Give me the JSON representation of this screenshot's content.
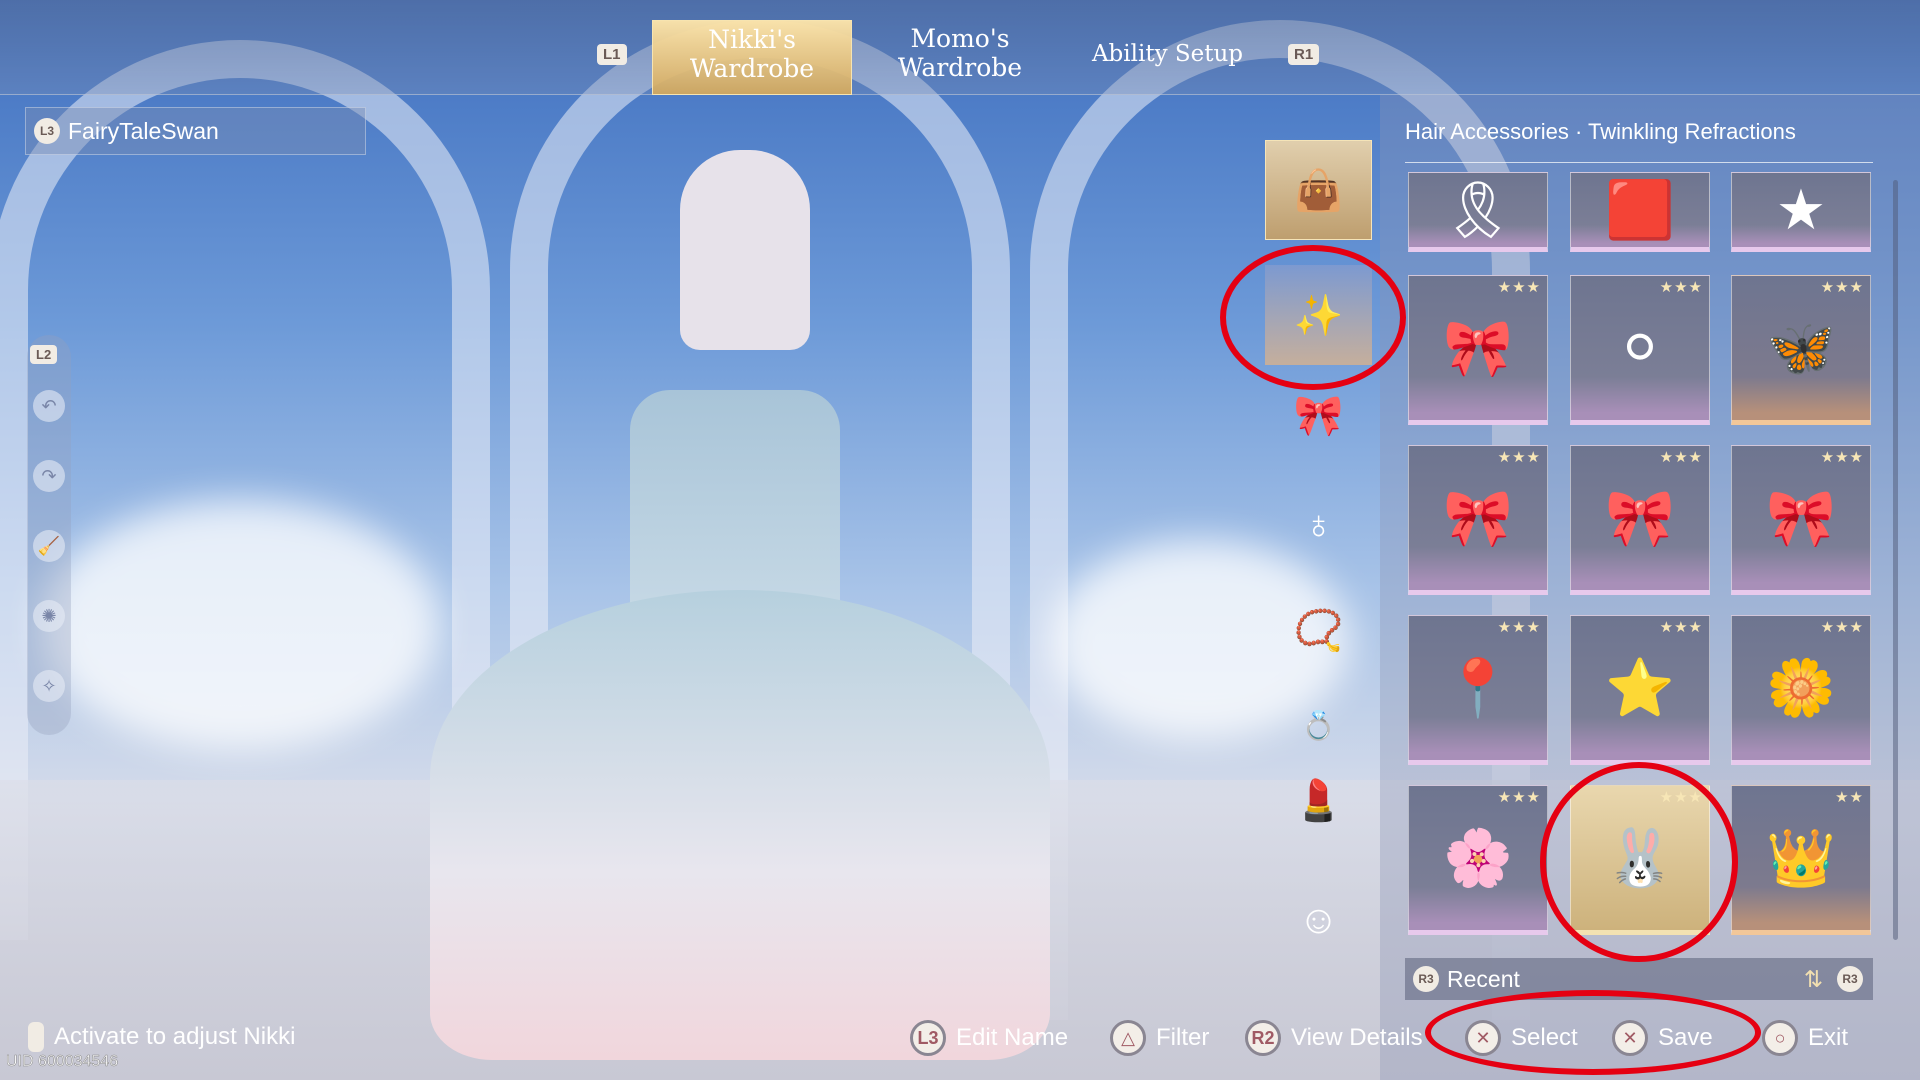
{
  "top_tabs": {
    "left_badge": "L1",
    "right_badge": "R1",
    "tabs": [
      {
        "label": "Nikki's Wardrobe",
        "active": true
      },
      {
        "label": "Momo's Wardrobe",
        "active": false
      },
      {
        "label": "Ability Setup",
        "active": false
      }
    ]
  },
  "outfit_name": {
    "badge": "L3",
    "value": "FairyTaleSwan"
  },
  "left_tools": {
    "badge": "L2",
    "icons": [
      "undo-icon",
      "redo-icon",
      "broom-icon",
      "pose-icon",
      "filter-effect-icon"
    ]
  },
  "categories": [
    {
      "icon": "bag-icon",
      "glyph": "👜",
      "selected": true
    },
    {
      "icon": "hair-accessory-icon",
      "glyph": "✨",
      "selected": false
    },
    {
      "icon": "hat-icon",
      "glyph": "🎀"
    },
    {
      "icon": "earrings-icon",
      "glyph": "♁"
    },
    {
      "icon": "necklace-icon",
      "glyph": "📿"
    },
    {
      "icon": "ring-icon",
      "glyph": "💍"
    },
    {
      "icon": "makeup-icon",
      "glyph": "💄"
    },
    {
      "icon": "face-icon",
      "glyph": "☺"
    }
  ],
  "panel": {
    "title": "Hair Accessories · Twinkling Refractions",
    "items": [
      {
        "glyph": "🎗",
        "stars": "",
        "style": ""
      },
      {
        "glyph": "🟥",
        "stars": "",
        "style": ""
      },
      {
        "glyph": "★",
        "stars": "",
        "style": ""
      },
      {
        "glyph": "🎀",
        "stars": "★★★",
        "style": ""
      },
      {
        "glyph": "⚪",
        "stars": "★★★",
        "style": ""
      },
      {
        "glyph": "🦋",
        "stars": "★★★",
        "style": "orange"
      },
      {
        "glyph": "🎀",
        "stars": "★★★",
        "style": ""
      },
      {
        "glyph": "🎀",
        "stars": "★★★",
        "style": ""
      },
      {
        "glyph": "🎀",
        "stars": "★★★",
        "style": ""
      },
      {
        "glyph": "📍",
        "stars": "★★★",
        "style": ""
      },
      {
        "glyph": "⭐",
        "stars": "★★★",
        "style": ""
      },
      {
        "glyph": "🌼",
        "stars": "★★★",
        "style": ""
      },
      {
        "glyph": "🌸",
        "stars": "★★★",
        "style": ""
      },
      {
        "glyph": "🐰",
        "stars": "★★★",
        "style": "gold"
      },
      {
        "glyph": "👑",
        "stars": "★★",
        "style": "orange"
      }
    ],
    "sort": {
      "badge": "R3",
      "label": "Recent"
    }
  },
  "bottom": {
    "activate": "Activate to adjust Nikki",
    "uid": "UID 600034546",
    "actions": [
      {
        "icon": "L3",
        "label": "Edit Name"
      },
      {
        "icon": "△",
        "label": "Filter"
      },
      {
        "icon": "R2",
        "label": "View Details"
      },
      {
        "icon": "✕",
        "label": "Select"
      },
      {
        "icon": "✕",
        "label": "Save"
      },
      {
        "icon": "○",
        "label": "Exit"
      }
    ]
  },
  "colors": {
    "highlight_ring": "#e50012",
    "selected_gold": "#d8b57a"
  }
}
